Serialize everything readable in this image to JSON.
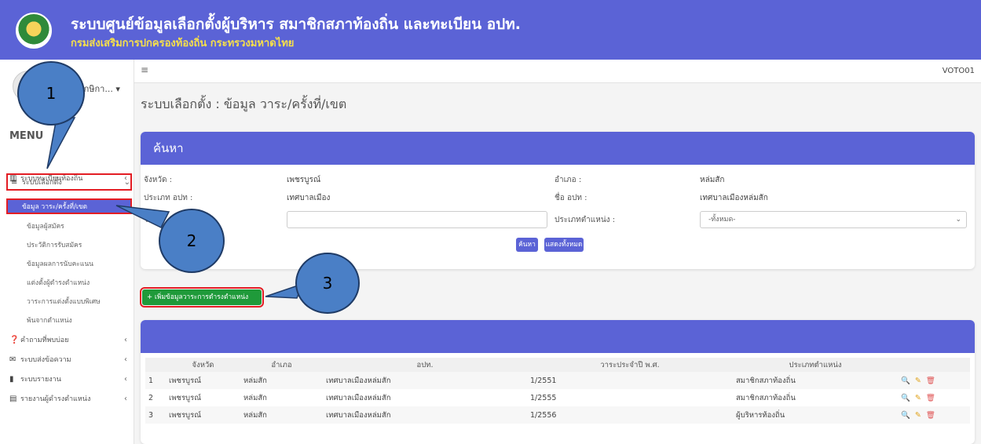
{
  "header": {
    "title": "ระบบศูนย์ข้อมูลเลือกตั้งผู้บริหาร สมาชิกสภาท้องถิ่น และทะเบียน อปท.",
    "subtitle": "กรมส่งเสริมการปกครองท้องถิ่น กระทรวงมหาดไทย"
  },
  "topnav": {
    "user_code": "VOTO01",
    "user_name": "อักษิกา..."
  },
  "sidebar": {
    "menu_title": "MENU",
    "items": [
      {
        "label": "ระบบทะเบียนท้องถิ่น"
      },
      {
        "label": "ระบบเลือกตั้ง"
      },
      {
        "label": "คำถามที่พบบ่อย"
      },
      {
        "label": "ระบบส่งข้อความ"
      },
      {
        "label": "ระบบรายงาน"
      },
      {
        "label": "รายงานผู้ดำรงตำแหน่ง"
      }
    ],
    "sub_items": [
      {
        "label": "ข้อมูล วาระ/ครั้งที่/เขต"
      },
      {
        "label": "ข้อมูลผู้สมัคร"
      },
      {
        "label": "ประวัติการรับสมัคร"
      },
      {
        "label": "ข้อมูลผลการนับคะแนน"
      },
      {
        "label": "แต่งตั้งผู้ดำรงตำแหน่ง"
      },
      {
        "label": "วาระการแต่งตั้งแบบพิเศษ"
      },
      {
        "label": "พ้นจากตำแหน่ง"
      }
    ]
  },
  "page": {
    "title": "ระบบเลือกตั้ง : ข้อมูล วาระ/ครั้งที่/เขต"
  },
  "search": {
    "header": "ค้นหา",
    "province_label": "จังหวัด :",
    "province_value": "เพชรบูรณ์",
    "district_label": "อำเภอ :",
    "district_value": "หล่มสัก",
    "org_type_label": "ประเภท อปท :",
    "org_type_value": "เทศบาลเมือง",
    "org_name_label": "ชื่อ อปท :",
    "org_name_value": "เทศบาลเมืองหล่มสัก",
    "term_label": "วาระ:",
    "position_type_label": "ประเภทตำแหน่ง :",
    "position_type_value": "-ทั้งหมด-",
    "search_button": "ค้นหา",
    "show_all_button": "แสดงทั้งหมด"
  },
  "add_button": "+ เพิ่มข้อมูลวาระการดำรงตำแหน่ง",
  "table": {
    "columns": [
      "",
      "จังหวัด",
      "อำเภอ",
      "อปท.",
      "วาระประจำปี พ.ศ.",
      "ประเภทตำแหน่ง",
      ""
    ],
    "rows": [
      [
        "1",
        "เพชรบูรณ์",
        "หล่มสัก",
        "เทศบาลเมืองหล่มสัก",
        "1/2551",
        "สมาชิกสภาท้องถิ่น"
      ],
      [
        "2",
        "เพชรบูรณ์",
        "หล่มสัก",
        "เทศบาลเมืองหล่มสัก",
        "1/2555",
        "สมาชิกสภาท้องถิ่น"
      ],
      [
        "3",
        "เพชรบูรณ์",
        "หล่มสัก",
        "เทศบาลเมืองหล่มสัก",
        "1/2556",
        "ผู้บริหารท้องถิ่น"
      ]
    ]
  },
  "callouts": [
    "1",
    "2",
    "3"
  ],
  "icons": {
    "view": "search-icon",
    "edit": "edit-icon",
    "delete": "trash-icon"
  },
  "colors": {
    "primary": "#5b63d6",
    "accent_red": "#e31d24",
    "success": "#1f9a3a",
    "title_yellow": "#f7e04a"
  }
}
